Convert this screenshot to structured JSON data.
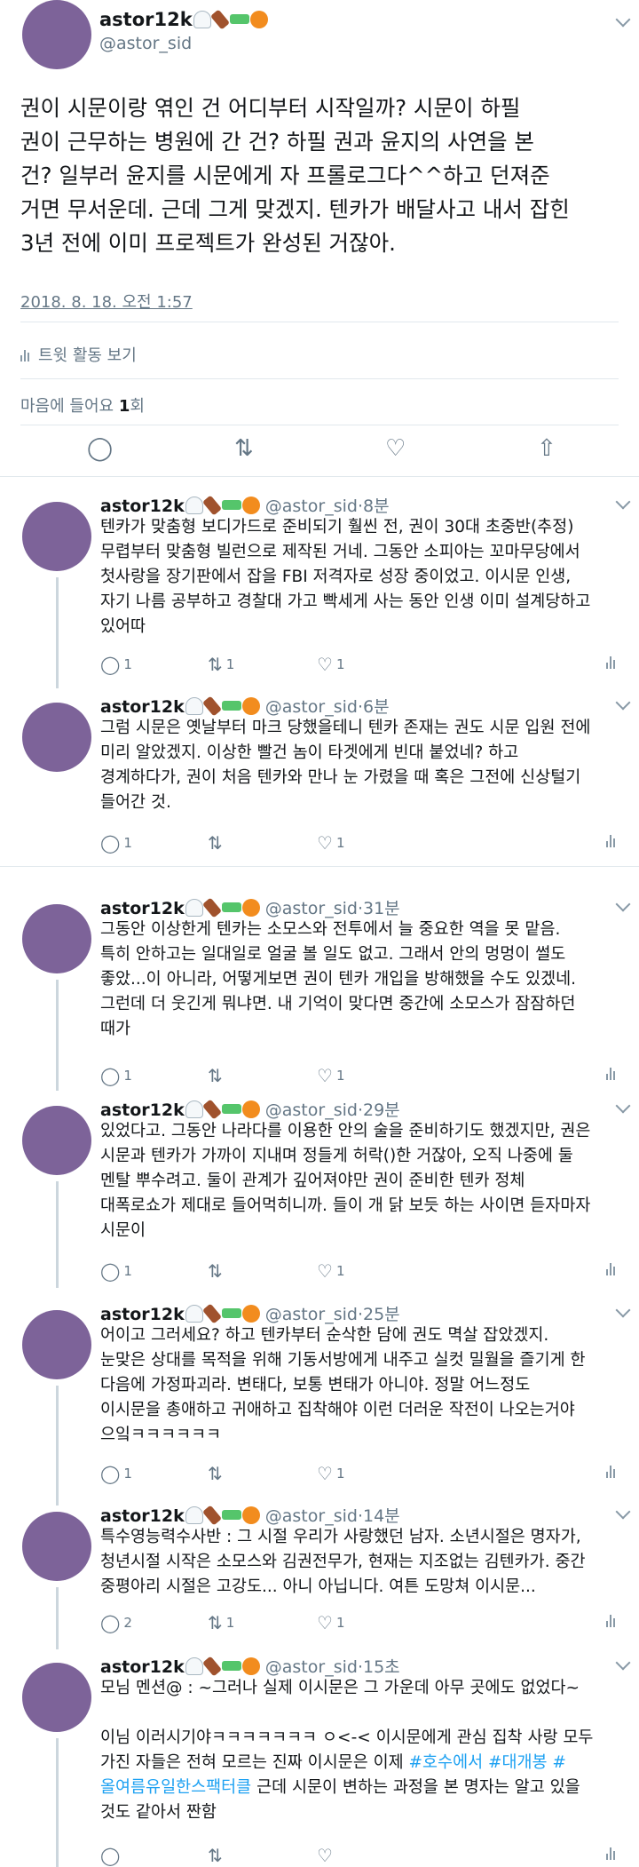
{
  "main_tweet": {
    "name": "astor12k",
    "handle": "@astor_sid",
    "text": "권이 시문이랑 엮인 건 어디부터 시작일까? 시문이 하필\n권이 근무하는 병원에 간 건? 하필 권과 윤지의 사연을 본\n건? 일부러 윤지를 시문에게 자 프롤로그다^^하고 던져준\n거면 무서운데. 근데 그게 맞겠지. 텐카가 배달사고 내서 잡힌\n3년 전에 이미 프로젝트가 완성된 거잖아.",
    "timestamp": "2018. 8. 18. 오전 1:57",
    "activity_label": "트윗 활동 보기",
    "likes_prefix": "마음에 들어요 ",
    "likes_count": "1",
    "likes_suffix": "회"
  },
  "icons": {
    "reply": "reply-icon",
    "retweet": "retweet-icon",
    "like": "heart-icon",
    "share": "share-icon",
    "analytics": "analytics-icon",
    "caret": "chevron-down-icon"
  },
  "colors": {
    "avatar": "#7d6399",
    "link": "#1da1f2",
    "muted": "#657786"
  },
  "replies": [
    {
      "name": "astor12k",
      "handle": "@astor_sid",
      "time": "8분",
      "text": "텐카가 맞춤형 보디가드로 준비되기 훨씬 전, 권이 30대 초중반(추정)\n무렵부터 맞춤형 빌런으로 제작된 거네. 그동안 소피아는 꼬마무당에서\n첫사랑을 장기판에서 잡을 FBI 저격자로 성장 중이었고. 이시문 인생,\n자기 나름 공부하고 경찰대 가고 빡세게 사는 동안 인생 이미 설계당하고\n있어따",
      "reply_count": "1",
      "retweet_count": "1",
      "like_count": "1"
    },
    {
      "name": "astor12k",
      "handle": "@astor_sid",
      "time": "6분",
      "text": "그럼 시문은 옛날부터 마크 당했을테니 텐카 존재는 권도 시문 입원 전에\n미리 알았겠지. 이상한 빨건 놈이 타겟에게 빈대 붙었네? 하고\n경계하다가, 권이 처음 텐카와 만나 눈 가렸을 때 혹은 그전에 신상털기\n들어간 것.",
      "reply_count": "1",
      "retweet_count": "",
      "like_count": "1"
    },
    {
      "name": "astor12k",
      "handle": "@astor_sid",
      "time": "31분",
      "text": "그동안 이상한게 텐카는 소모스와 전투에서 늘 중요한 역을 못 맡음.\n특히 안하고는 일대일로 얼굴 볼 일도 없고. 그래서 안의 멍멍이 썰도\n좋았...이 아니라, 어떻게보면 권이 텐카 개입을 방해했을 수도 있겠네.\n그런데 더 웃긴게 뭐냐면. 내 기억이 맞다면 중간에 소모스가 잠잠하던\n때가",
      "reply_count": "1",
      "retweet_count": "",
      "like_count": "1"
    },
    {
      "name": "astor12k",
      "handle": "@astor_sid",
      "time": "29분",
      "text": "있었다고. 그동안 나라다를 이용한 안의 술을 준비하기도 했겠지만, 권은\n시문과 텐카가 가까이 지내며 정들게 허락()한 거잖아, 오직 나중에 둘\n멘탈 뿌수려고. 둘이 관계가 깊어져야만 권이 준비한 텐카 정체\n대폭로쇼가 제대로 들어먹히니까. 들이 개 닭 보듯 하는 사이면 듣자마자\n시문이",
      "reply_count": "1",
      "retweet_count": "",
      "like_count": "1"
    },
    {
      "name": "astor12k",
      "handle": "@astor_sid",
      "time": "25분",
      "text": "어이고 그러세요? 하고 텐카부터 순삭한 담에 권도 멱살 잡았겠지.\n눈맞은 상대를 목적을 위해 기동서방에게 내주고 실컷 밀월을 즐기게 한\n다음에 가정파괴라. 변태다, 보통 변태가 아니야. 정말 어느정도\n이시문을 총애하고 귀애하고 집착해야 이런 더러운 작전이 나오는거야\n으잌ㅋㅋㅋㅋㅋㅋ",
      "reply_count": "1",
      "retweet_count": "",
      "like_count": "1"
    },
    {
      "name": "astor12k",
      "handle": "@astor_sid",
      "time": "14분",
      "text": "특수영능력수사반 : 그 시절 우리가 사랑했던 남자. 소년시절은 명자가,\n청년시절 시작은 소모스와 김권전무가, 현재는 지조없는 김텐카가. 중간\n중평아리 시절은 고강도... 아니 아닙니다. 여튼 도망쳐 이시문...",
      "reply_count": "2",
      "retweet_count": "1",
      "like_count": "1"
    },
    {
      "name": "astor12k",
      "handle": "@astor_sid",
      "time": "15초",
      "text_before": "모님 멘션@ : ~그러나 실제 이시문은 그 가운데 아무 곳에도 없었다~\n\n이님 이러시기야ㅋㅋㅋㅋㅋㅋㅋ ㅇ<-< 이시문에게 관심 집착 사랑 모두\n가진 자들은 전혀 모르는 진짜 이시문은 이제 ",
      "hashtags": "#호수에서 #대개봉 #\n올여름유일한스팩터클",
      "text_after": " 근데 시문이 변하는 과정을 본 명자는 알고 있을\n것도 같아서 짠함",
      "reply_count": "",
      "retweet_count": "",
      "like_count": ""
    }
  ]
}
